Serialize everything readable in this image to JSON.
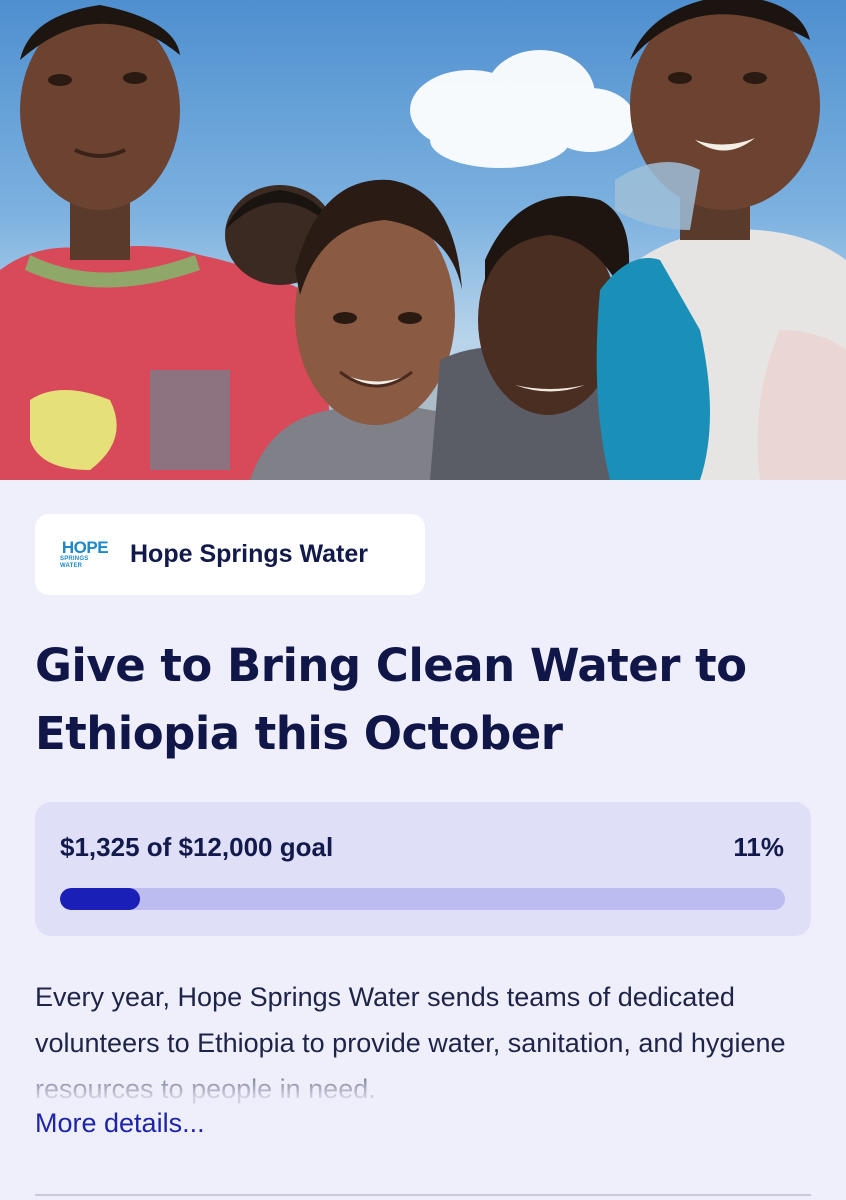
{
  "hero": {
    "image_alt": "",
    "icon": "hero-photo"
  },
  "org": {
    "logo_line1": "HOPE",
    "logo_line2": "SPRINGS WATER",
    "name": "Hope Springs Water"
  },
  "campaign": {
    "title": "Give to Bring Clean Water to Ethiopia this October",
    "progress_text": "$1,325 of $12,000 goal",
    "progress_percent": "11%",
    "progress_fraction": 0.11,
    "description": "Every year, Hope Springs Water sends teams of dedicated volunteers to Ethiopia to provide water, sanitation, and hygiene resources to people in need.",
    "more_link": "More details..."
  },
  "colors": {
    "page_bg": "#efeffb",
    "accent": "#1a1fb8",
    "track": "#bcbcf0",
    "card": "#dfdff8",
    "title": "#101748"
  }
}
